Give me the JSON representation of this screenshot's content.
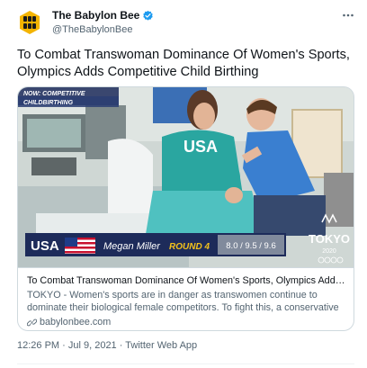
{
  "author": {
    "name": "The Babylon Bee",
    "handle": "@TheBabylonBee"
  },
  "tweet": {
    "text": "To Combat Transwoman Dominance Of Women's Sports, Olympics Adds Competitive Child Birthing"
  },
  "card": {
    "image": {
      "badge_line1": "NOW: COMPETITIVE",
      "badge_line2": "CHILDBIRTHING",
      "shirt_text": "USA",
      "country": "USA",
      "athlete": "Megan Miller",
      "round": "ROUND 4",
      "scores": "8.0 / 9.5 / 9.6",
      "games_logo": "TOKYO",
      "games_year": "2020"
    },
    "title": "To Combat Transwoman Dominance Of Women's Sports, Olympics Adds Comp...",
    "description": "TOKYO - Women's sports are in danger as transwomen continue to dominate their biological female competitors. To fight this, a conservative lobbyist group ...",
    "domain": "babylonbee.com"
  },
  "meta": {
    "time": "12:26 PM · Jul 9, 2021 · ",
    "app": "Twitter Web App"
  },
  "colors": {
    "brand_yellow": "#f4b400",
    "verified_blue": "#1d9bf0",
    "banner_navy": "#1d2b5a",
    "shirt_teal": "#2aa6a0",
    "scrubs_blue": "#3b6fb5"
  }
}
